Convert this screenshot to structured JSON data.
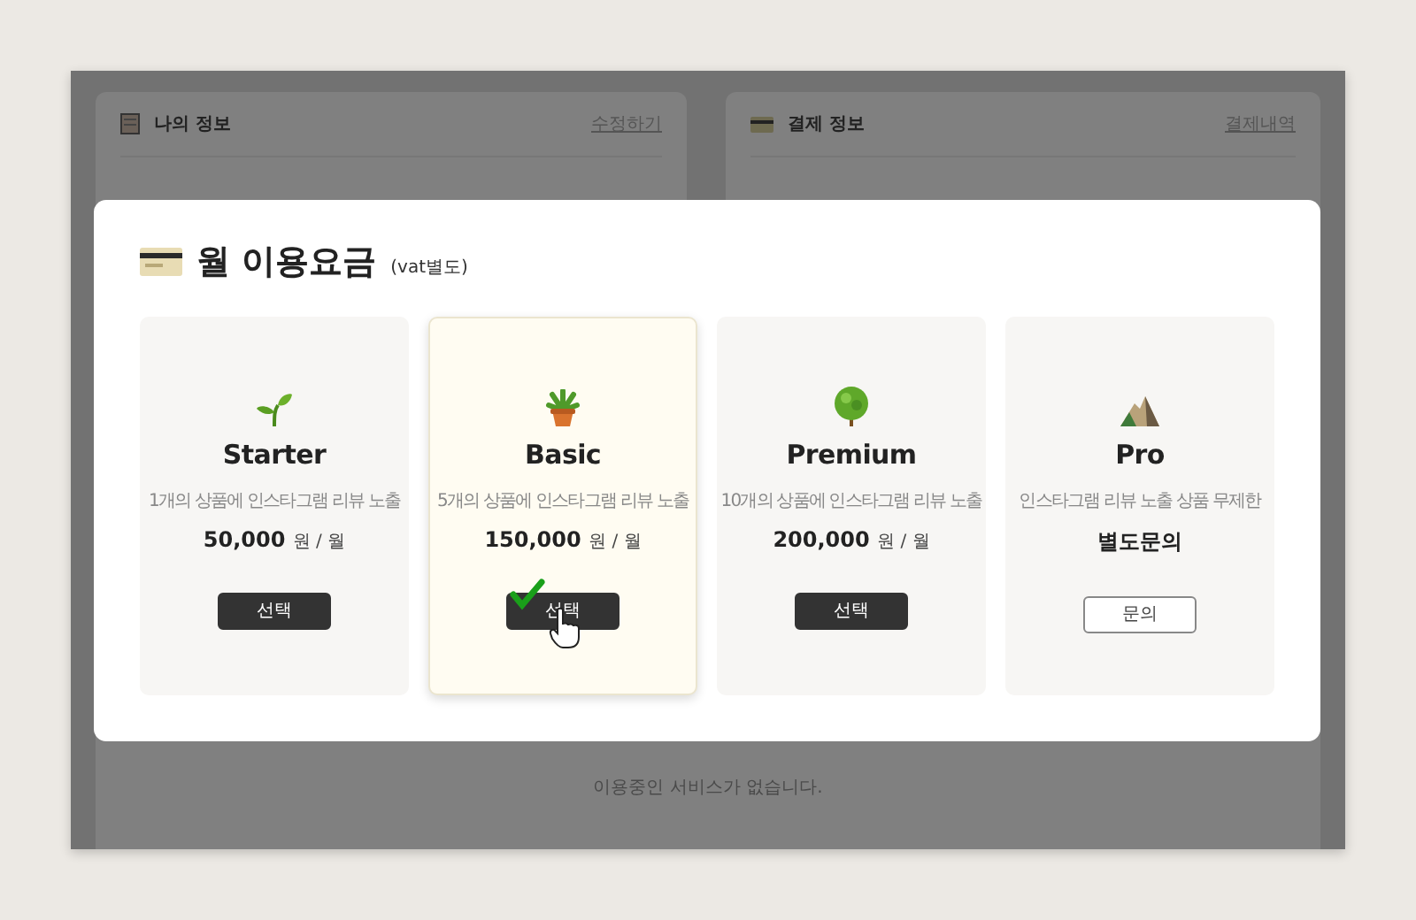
{
  "background": {
    "panels": [
      {
        "title": "나의 정보",
        "link": "수정하기"
      },
      {
        "title": "결제 정보",
        "link": "결제내역"
      }
    ],
    "empty_message": "이용중인 서비스가 없습니다."
  },
  "modal": {
    "title": "월 이용요금",
    "note": "(vat별도)",
    "plans": [
      {
        "kind": "priced",
        "name": "Starter",
        "description": "1개의 상품에 인스타그램 리뷰 노출",
        "price": "50,000",
        "unit": "원 / 월",
        "button": "선택",
        "selected": false
      },
      {
        "kind": "priced",
        "name": "Basic",
        "description": "5개의 상품에 인스타그램 리뷰 노출",
        "price": "150,000",
        "unit": "원 / 월",
        "button": "선택",
        "selected": true
      },
      {
        "kind": "priced",
        "name": "Premium",
        "description": "10개의 상품에 인스타그램 리뷰 노출",
        "price": "200,000",
        "unit": "원 / 월",
        "button": "선택",
        "selected": false
      },
      {
        "kind": "inquiry",
        "name": "Pro",
        "description": "인스타그램 리뷰 노출 상품 무제한",
        "price": "별도문의",
        "button": "문의",
        "selected": false
      }
    ]
  }
}
